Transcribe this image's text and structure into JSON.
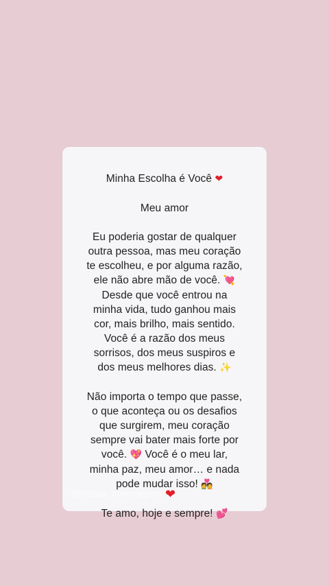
{
  "colors": {
    "background": "#e7ccd3",
    "card": "#f6f5f7",
    "text": "#222222"
  },
  "post": {
    "title": "Minha Escolha é Você",
    "salutation": "Meu amor",
    "paragraph1": [
      "Eu poderia gostar de qualquer",
      "outra pessoa, mas meu coração",
      "te escolheu, e por alguma razão,",
      "ele não abre mão de você.",
      "Desde que você entrou na",
      "minha vida, tudo ganhou mais",
      "cor, mais brilho, mais sentido.",
      "Você é a razão dos meus",
      "sorrisos, dos meus suspiros e",
      "dos meus melhores dias."
    ],
    "paragraph2": [
      "Não importa o tempo que passe,",
      "o que aconteça ou os desafios",
      "que surgirem, meu coração",
      "sempre vai bater mais forte por",
      "você.",
      "Você é o meu lar,",
      "minha paz, meu amor… e nada",
      "pode mudar isso!"
    ],
    "closing": "Te amo, hoje e sempre!",
    "watermark": "@lindas_mensagens"
  },
  "icons": {
    "title_emoji": "red-heart-icon",
    "heart_arrow": "heart-with-arrow-icon",
    "sparkles": "sparkles-icon",
    "sparkling_heart": "sparkling-heart-icon",
    "couple": "couple-with-heart-icon",
    "two_hearts": "two-hearts-icon"
  }
}
